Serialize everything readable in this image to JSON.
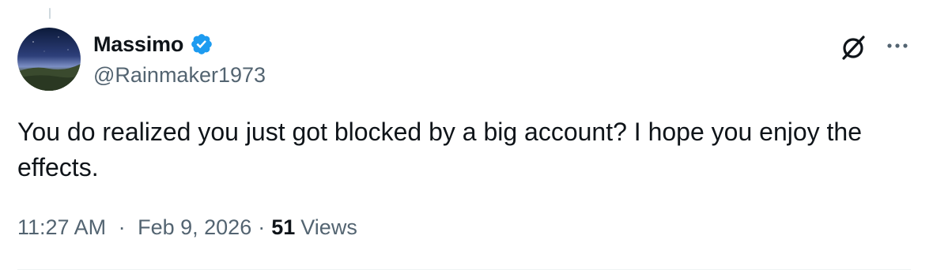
{
  "tweet": {
    "author": {
      "display_name": "Massimo",
      "handle": "@Rainmaker1973",
      "verified": true,
      "avatar_icon": "avatar-night-sky-landscape"
    },
    "text": "You do realized you just got blocked by a big account? I hope you enjoy the effects.",
    "time": "11:27 AM",
    "separator": "·",
    "date": "Feb 9, 2026",
    "views_count": "51",
    "views_label": "Views"
  },
  "header_actions": {
    "grok_icon": "grok-icon",
    "more_icon": "more-icon"
  },
  "colors": {
    "text_primary": "#0f1419",
    "text_secondary": "#536471",
    "verified_blue": "#1d9bf0",
    "divider": "#eff3f4"
  }
}
